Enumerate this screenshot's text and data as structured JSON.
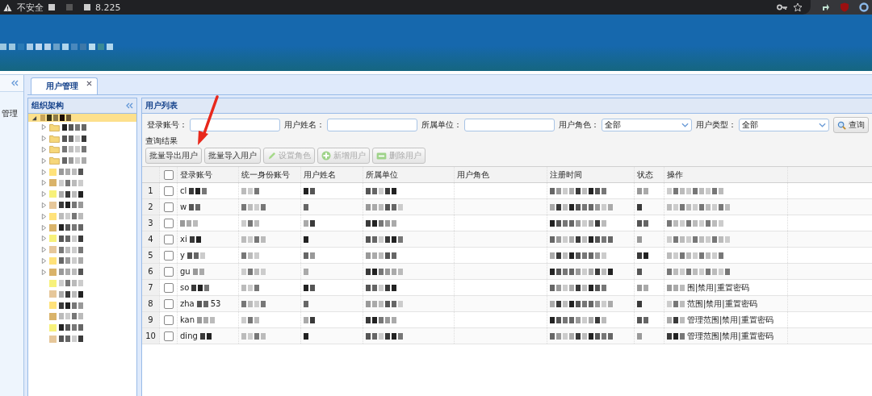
{
  "browser": {
    "security_label": "不安全",
    "address": "8.225"
  },
  "sidebar": {
    "items": [
      {
        "label": "管理"
      }
    ]
  },
  "tabs": [
    {
      "label": "用户管理",
      "selected": true
    }
  ],
  "org_panel": {
    "title": "组织架构",
    "root": {
      "expanded": true,
      "selected": true,
      "children": [
        {
          "expandable": true,
          "folder": true
        },
        {
          "expandable": true,
          "folder": true
        },
        {
          "expandable": true,
          "folder": true
        },
        {
          "expandable": true,
          "folder": true
        },
        {
          "expandable": true,
          "folder": false
        },
        {
          "expandable": true,
          "folder": false
        },
        {
          "expandable": true,
          "folder": false
        },
        {
          "expandable": true,
          "folder": false
        },
        {
          "expandable": true,
          "folder": false
        },
        {
          "expandable": true,
          "folder": false
        },
        {
          "expandable": true,
          "folder": false
        },
        {
          "expandable": true,
          "folder": false
        },
        {
          "expandable": true,
          "folder": false
        },
        {
          "expandable": true,
          "folder": false
        },
        {
          "expandable": false,
          "folder": false
        },
        {
          "expandable": false,
          "folder": false
        },
        {
          "expandable": false,
          "folder": false
        },
        {
          "expandable": false,
          "folder": false
        },
        {
          "expandable": false,
          "folder": false
        },
        {
          "expandable": false,
          "folder": false
        }
      ]
    }
  },
  "user_list": {
    "title": "用户列表",
    "filters": [
      {
        "label": "登录账号：",
        "kind": "text"
      },
      {
        "label": "用户姓名：",
        "kind": "text"
      },
      {
        "label": "所属单位：",
        "kind": "text"
      },
      {
        "label": "用户角色：",
        "kind": "select",
        "value": "全部"
      },
      {
        "label": "用户类型：",
        "kind": "select",
        "value": "全部"
      }
    ],
    "query_button": "查询",
    "results_label": "查询结果",
    "toolbar": [
      {
        "label": "批量导出用户",
        "kind": "plain",
        "disabled": false
      },
      {
        "label": "批量导入用户",
        "kind": "plain",
        "disabled": false
      },
      {
        "label": "设置角色",
        "kind": "pencil",
        "disabled": true
      },
      {
        "label": "新增用户",
        "kind": "plus",
        "disabled": true
      },
      {
        "label": "删除用户",
        "kind": "minus",
        "disabled": true
      }
    ],
    "header_checkbox": {
      "checked": false
    },
    "columns": [
      "登录账号",
      "统一身份账号",
      "用户姓名",
      "所属单位",
      "用户角色",
      "注册时间",
      "状态",
      "操作"
    ],
    "rows": [
      {
        "number": "1",
        "login": "cl",
        "checked": false
      },
      {
        "number": "2",
        "login": "w",
        "checked": false
      },
      {
        "number": "3",
        "checked": false
      },
      {
        "number": "4",
        "login": "xi",
        "checked": false
      },
      {
        "number": "5",
        "login": "y",
        "checked": false
      },
      {
        "number": "6",
        "login": "gu",
        "checked": false
      },
      {
        "number": "7",
        "login": "so",
        "checked": false,
        "operations": "围|禁用|重置密码"
      },
      {
        "number": "8",
        "login": "zha",
        "login_suffix": "53",
        "checked": false,
        "operations": "范围|禁用|重置密码"
      },
      {
        "number": "9",
        "login": "kan",
        "checked": false,
        "operations": "管理范围|禁用|重置密码"
      },
      {
        "number": "10",
        "login": "ding",
        "checked": false,
        "operations": "管理范围|禁用|重置密码"
      }
    ]
  },
  "annotation": {
    "kind": "arrow"
  }
}
